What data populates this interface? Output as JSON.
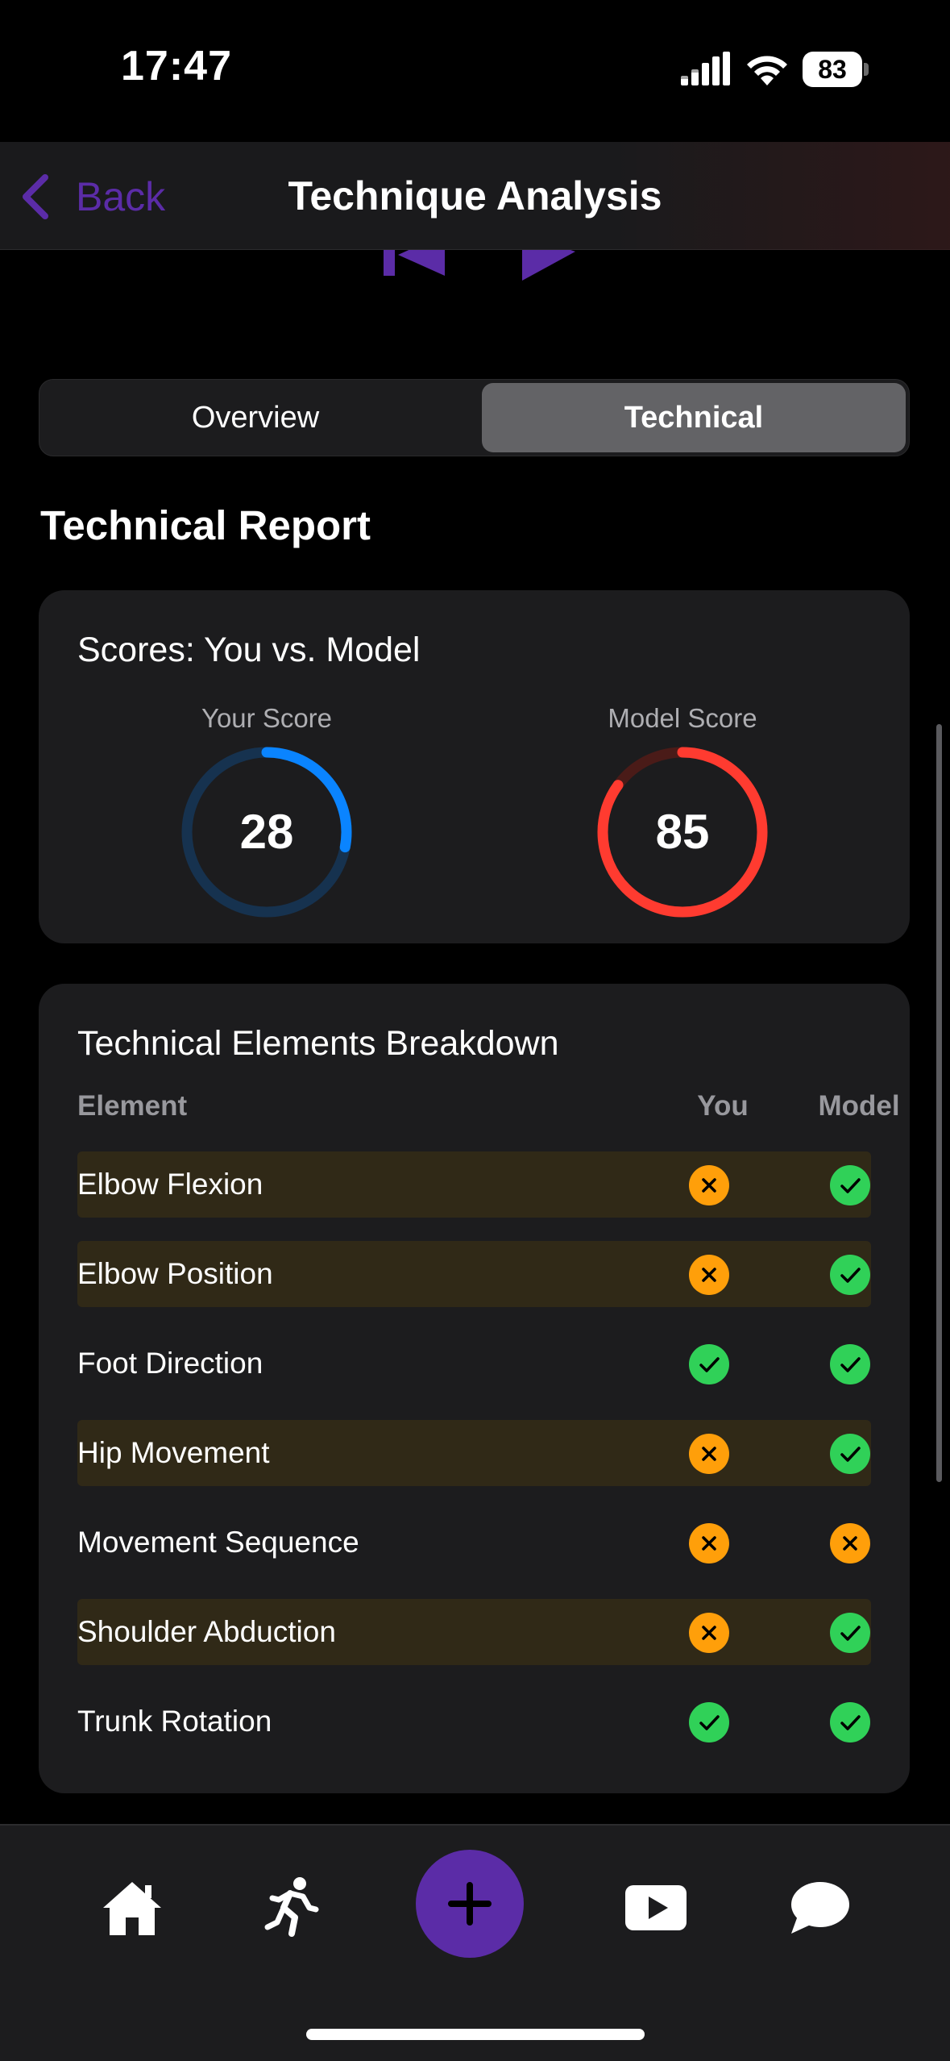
{
  "status_bar": {
    "time": "17:47",
    "battery": "83"
  },
  "nav": {
    "back_label": "Back",
    "title": "Technique Analysis"
  },
  "tabs": {
    "overview": "Overview",
    "technical": "Technical",
    "selected": "Technical"
  },
  "section_title": "Technical Report",
  "scores": {
    "title": "Scores: You vs. Model",
    "you": {
      "label": "Your Score",
      "value": "28",
      "max": 100,
      "color": "#0a84ff",
      "track": "#16324f"
    },
    "model": {
      "label": "Model Score",
      "value": "85",
      "max": 100,
      "color": "#ff3b30",
      "track": "#4a1b18"
    }
  },
  "breakdown": {
    "title": "Technical Elements Breakdown",
    "columns": {
      "element": "Element",
      "you": "You",
      "model": "Model"
    },
    "rows": [
      {
        "label": "Elbow Flexion",
        "you": "fail",
        "model": "pass"
      },
      {
        "label": "Elbow Position",
        "you": "fail",
        "model": "pass"
      },
      {
        "label": "Foot Direction",
        "you": "pass",
        "model": "pass"
      },
      {
        "label": "Hip Movement",
        "you": "fail",
        "model": "pass"
      },
      {
        "label": "Movement Sequence",
        "you": "fail",
        "model": "fail"
      },
      {
        "label": "Shoulder Abduction",
        "you": "fail",
        "model": "pass"
      },
      {
        "label": "Trunk Rotation",
        "you": "pass",
        "model": "pass"
      }
    ],
    "colors": {
      "pass": "#30d158",
      "fail": "#ff9f0a",
      "highlight_row": "#302917"
    }
  },
  "tab_bar": {
    "items": [
      "home-icon",
      "activity-icon",
      "add-icon",
      "video-icon",
      "chat-icon"
    ],
    "accent": "#5b2ca7"
  }
}
